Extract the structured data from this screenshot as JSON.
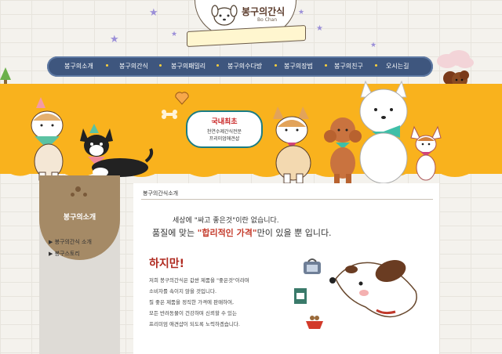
{
  "logo": {
    "title": "봉구의간식",
    "subtitle": "Bo Chan"
  },
  "nav": {
    "items": [
      "봉구의소개",
      "봉구의간식",
      "봉구의패밀리",
      "봉구의수다방",
      "봉구의장범",
      "봉구의친구",
      "오시는길"
    ]
  },
  "banner": {
    "speech_title": "국내최초",
    "speech_line1": "천연수제간식전문",
    "speech_line2": "프리미엄애견샵"
  },
  "sidebar": {
    "title": "봉구의소개",
    "items": [
      "봉구의간식 소개",
      "봉구스토리"
    ]
  },
  "content": {
    "breadcrumb": "봉구의간식소개",
    "line1": "세상에 \"싸고 좋은것\"이란 없습니다.",
    "line2_pre": "품질에 맞는 ",
    "line2_em": "\"합리적인 가격\"",
    "line2_post": "만이 있을 뿐 입니다.",
    "heading": "하지만!",
    "para": [
      "저희 봉구의간식은 값싼 제품을 \"좋은것\"이라며",
      "소비자를 속이지 않을 것입니다.",
      "질 좋은 제품을 정직한 가격에 판매하여,",
      "모든 반려동물이 건강하며 신뢰할 수 있는",
      "프리미엄 애견샵이 되도록 노력하겠습니다."
    ]
  },
  "colors": {
    "banner": "#f9b21d",
    "nav": "#3e567e",
    "sidebar_tag": "#a58a66",
    "accent": "#c43a2a"
  }
}
